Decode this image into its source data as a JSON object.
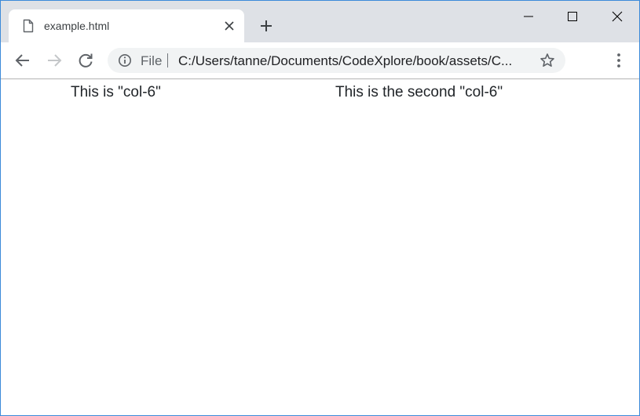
{
  "tab": {
    "title": "example.html",
    "icon": "file-icon"
  },
  "toolbar": {
    "scheme_label": "File",
    "url": "C:/Users/tanne/Documents/CodeXplore/book/assets/C..."
  },
  "page": {
    "columns": [
      {
        "text": "This is \"col-6\""
      },
      {
        "text": "This is the second \"col-6\""
      }
    ]
  },
  "colors": {
    "tabstrip_bg": "#dee1e6",
    "omnibox_bg": "#f1f3f4",
    "window_border": "#3c8ad9",
    "icon_gray": "#5f6368"
  }
}
